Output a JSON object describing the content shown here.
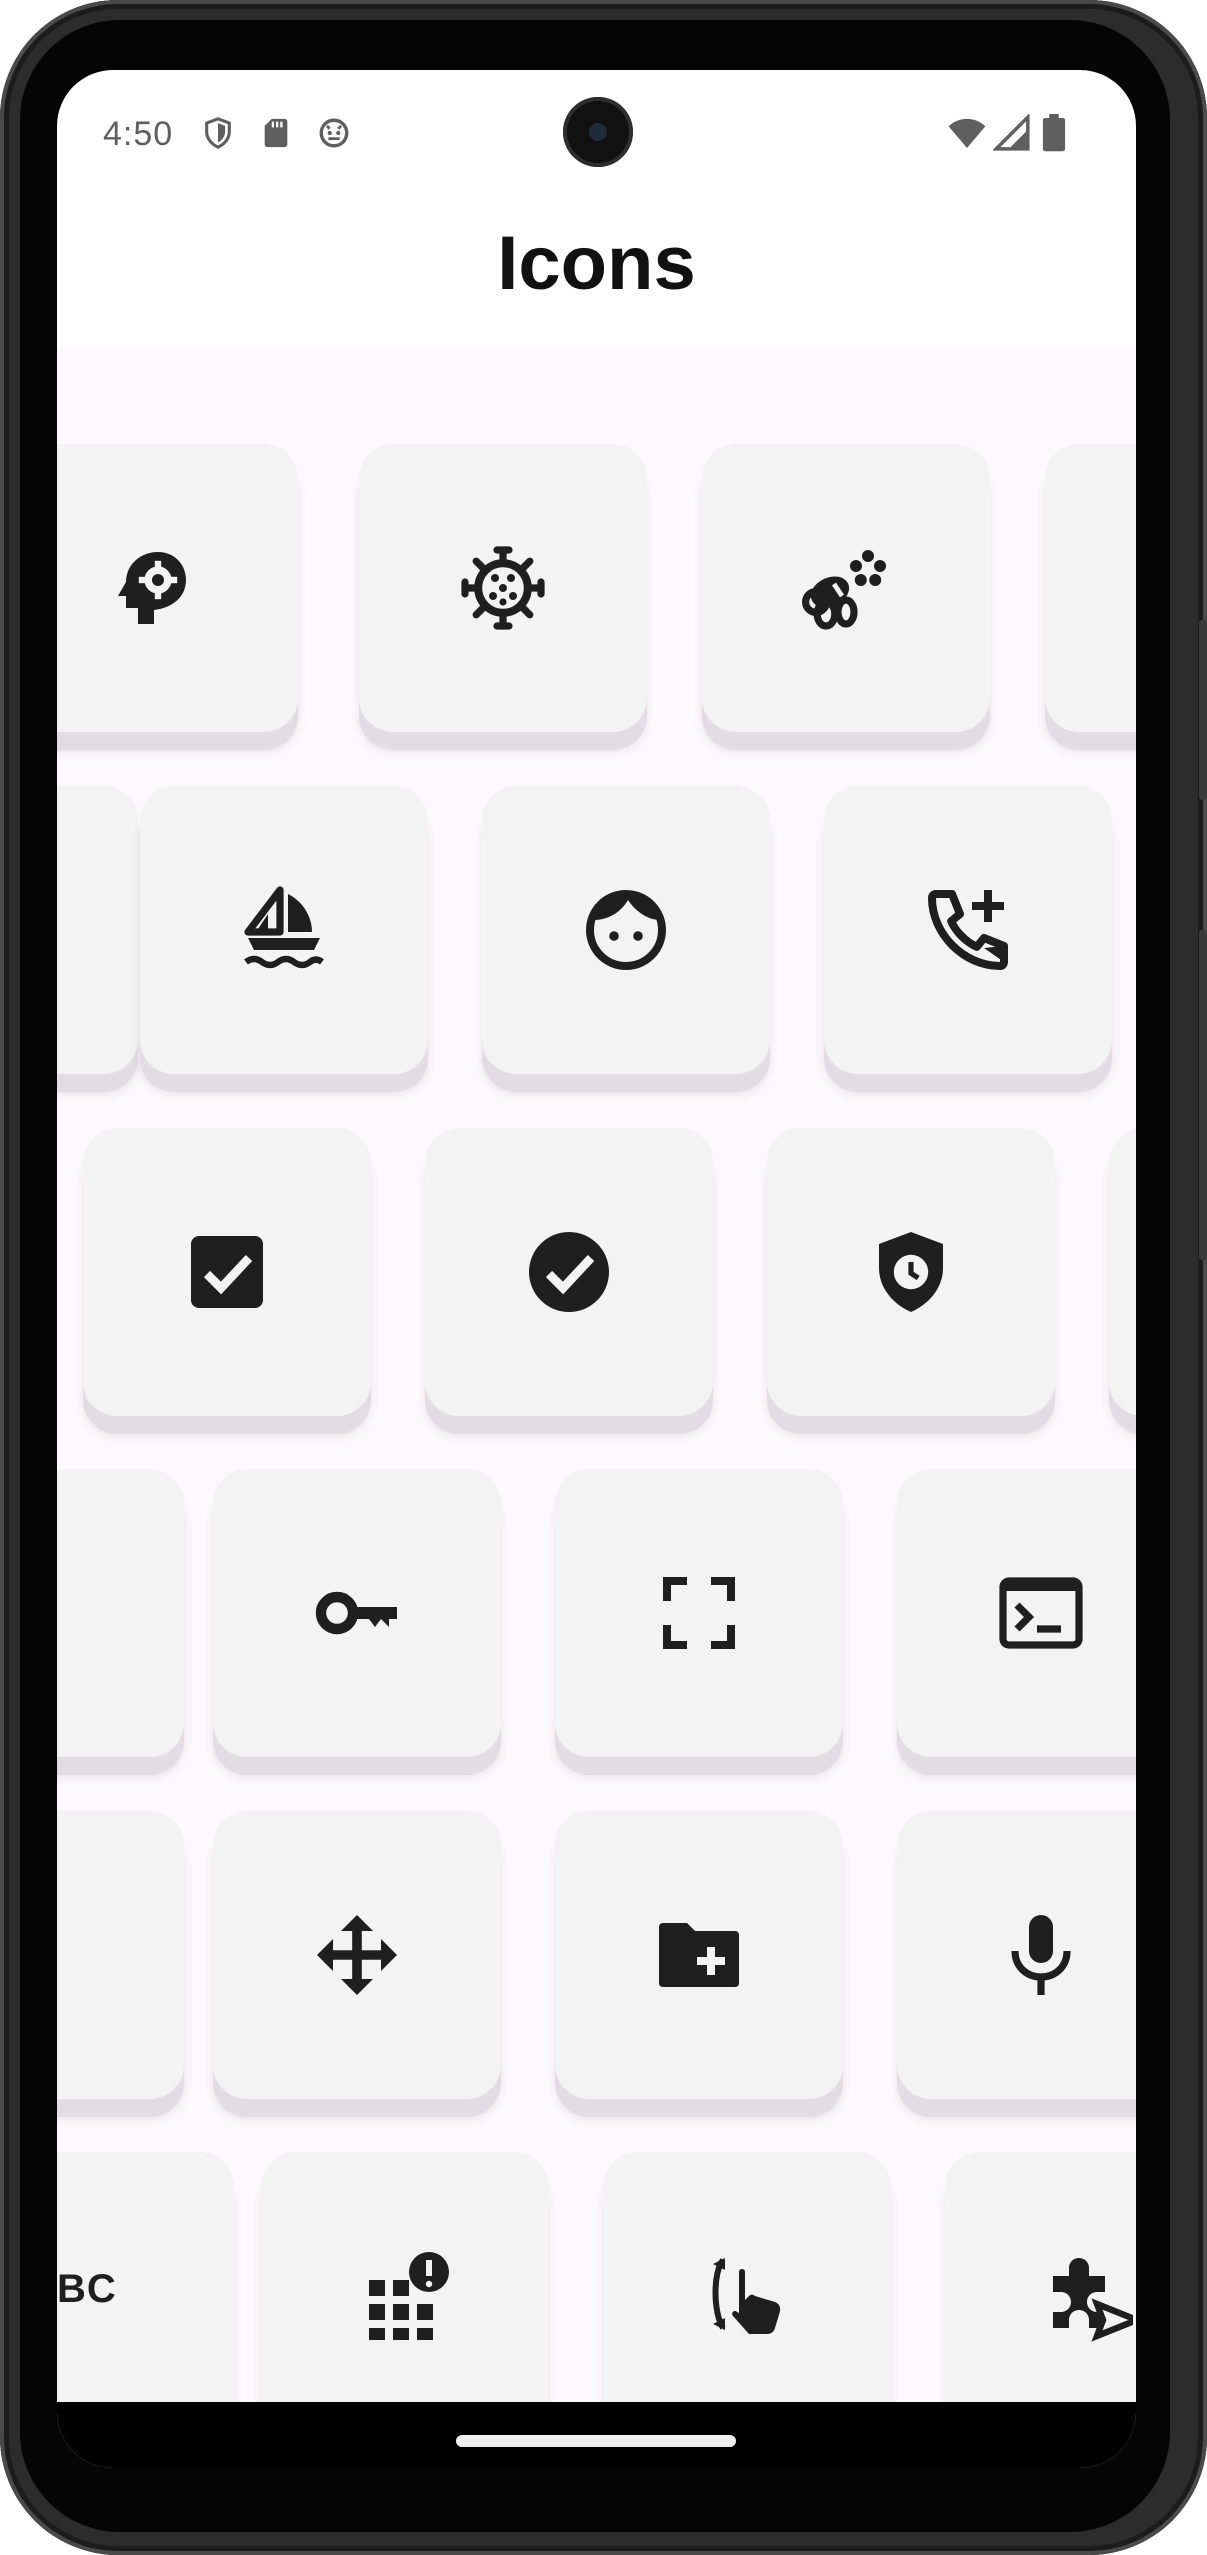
{
  "status_bar": {
    "time": "4:50",
    "left_icons": [
      "shield-icon",
      "sd-card-icon",
      "android-debug-icon"
    ],
    "right_icons": [
      "wifi-icon",
      "signal-icon",
      "battery-icon"
    ]
  },
  "screen": {
    "title": "Icons"
  },
  "icon_grid": {
    "rows": [
      [
        "psychology-icon",
        "coronavirus-icon",
        "emoji-nature-icon",
        "partial-icon"
      ],
      [
        "partial-icon",
        "sailing-icon",
        "face-icon",
        "add-call-icon"
      ],
      [
        "check-box-icon",
        "check-circle-icon",
        "gpp-maybe-clock-icon",
        "partial-icon"
      ],
      [
        "partial-icon",
        "vpn-key-icon",
        "crop-free-icon",
        "terminal-icon"
      ],
      [
        "partial-icon",
        "open-with-icon",
        "create-new-folder-icon",
        "mic-icon"
      ],
      [
        "abc-icon",
        "app-registration-icon",
        "swipe-vertical-icon",
        "extension-send-icon"
      ]
    ],
    "partial_text": "BC"
  },
  "colors": {
    "icon": "#1f1f1f",
    "tile": "#f3f3f3",
    "tile_shadow": "#e2dde2",
    "grid_background": "#fdfafd"
  }
}
